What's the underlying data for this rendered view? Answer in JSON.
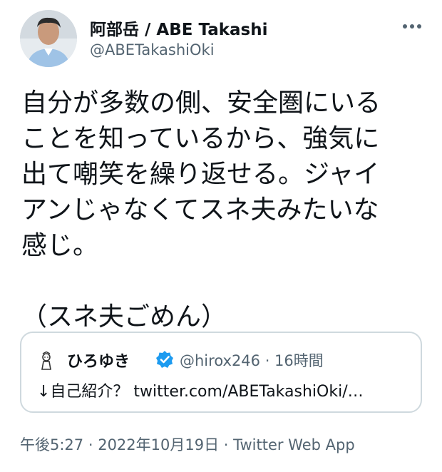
{
  "tweet": {
    "author": {
      "display_name": "阿部岳 / ABE Takashi",
      "handle": "@ABETakashiOki"
    },
    "more_icon": "more-horizontal-icon",
    "text_lines": [
      "自分が多数の側、安全圏にいる",
      "ことを知っているから、強気に",
      "出て嘲笑を繰り返せる。ジャイ",
      "アンじゃなくてスネ夫みたいな",
      "感じ。",
      "（スネ夫ごめん）"
    ],
    "quote": {
      "display_name": "ひろゆき",
      "verified_icon": "verified-badge-icon",
      "handle_time": "@hirox246 · 16時間",
      "text": "↓自己紹介？ twitter.com/ABETakashiOki/…"
    },
    "footer": {
      "time": "午後5:27",
      "sep1": " · ",
      "date": "2022年10月19日",
      "sep2": " · ",
      "source": "Twitter Web App"
    }
  },
  "colors": {
    "text": "#0f1419",
    "secondary": "#536471",
    "border": "#cfd9de",
    "verified": "#1d9bf0"
  }
}
